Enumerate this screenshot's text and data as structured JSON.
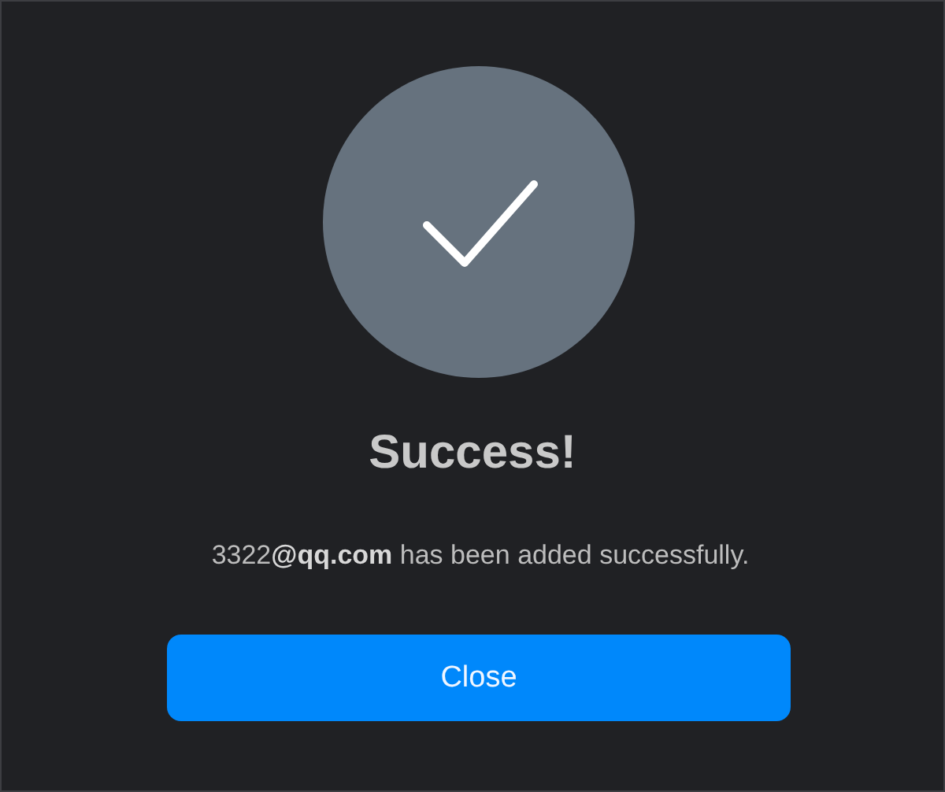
{
  "dialog": {
    "title": "Success!",
    "message": "3322**@qq.com** has been added successfully.",
    "button": "Close"
  }
}
